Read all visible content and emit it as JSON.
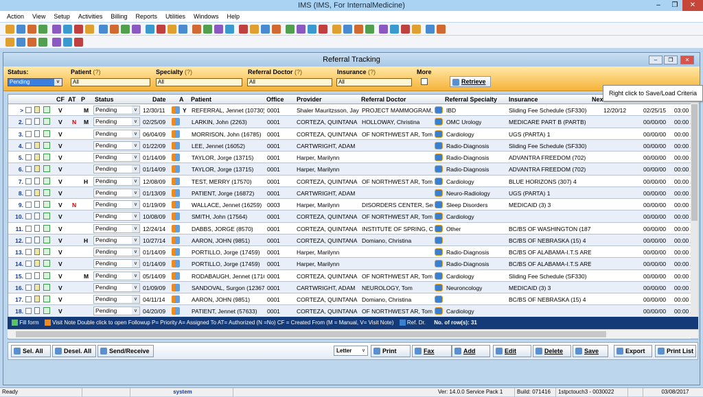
{
  "app": {
    "title": "IMS (IMS, For InternalMedicine)"
  },
  "menu": [
    "Action",
    "View",
    "Setup",
    "Activities",
    "Billing",
    "Reports",
    "Utilities",
    "Windows",
    "Help"
  ],
  "window": {
    "title": "Referral Tracking"
  },
  "filters": {
    "status_label": "Status:",
    "status_value": "Pending",
    "patient_label": "Patient",
    "patient_value": "All",
    "specialty_label": "Specialty",
    "specialty_value": "All",
    "refdoc_label": "Referral Doctor",
    "refdoc_value": "All",
    "insurance_label": "Insurance",
    "insurance_value": "All",
    "help": "(?)",
    "more_label": "More",
    "retrieve": "Retrieve"
  },
  "tooltip": "Right click to Save/Load Criteria",
  "columns": [
    "CF",
    "AT",
    "P",
    "Status",
    "Date",
    "A",
    "Patient",
    "Office",
    "Provider",
    "Referral Doctor",
    "Referral Specialty",
    "Insurance",
    "Nex"
  ],
  "rows": [
    {
      "n": ">",
      "doc": "y",
      "cf": "V",
      "at": "",
      "p": "M",
      "status": "Pending",
      "date": "12/30/11",
      "a": "Y",
      "patient": "REFERRAL, Jennet (10730)",
      "office": "0001",
      "provider": "Shaler Mauritzsson, Jay",
      "refdoc": "PROJECT MAMMOGRAM, J",
      "spec": "IBD",
      "ins": "Sliding Fee Schedule  (SF330)",
      "next": "12/20/12",
      "d2": "02/25/15",
      "t": "03:00 I"
    },
    {
      "n": "2.",
      "doc": "",
      "cf": "V",
      "at": "N",
      "p": "M",
      "status": "Pending",
      "date": "02/25/09",
      "a": "",
      "patient": "LARKIN, John (2263)",
      "office": "0001",
      "provider": "CORTEZA, QUINTANA",
      "refdoc": "HOLLOWAY, Christina",
      "spec": "OMC Urology",
      "ins": "MEDICARE PART B  (PARTB)",
      "next": "",
      "d2": "00/00/00",
      "t": "00:00 /"
    },
    {
      "n": "3.",
      "doc": "",
      "cf": "V",
      "at": "",
      "p": "",
      "status": "Pending",
      "date": "06/04/09",
      "a": "",
      "patient": "MORRISON, John (16785)",
      "office": "0001",
      "provider": "CORTEZA, QUINTANA",
      "refdoc": "OF NORTHWEST AR, Tom",
      "spec": "Cardiology",
      "ins": "UGS  (PARTA)  1",
      "next": "",
      "d2": "00/00/00",
      "t": "00:00 /"
    },
    {
      "n": "4.",
      "doc": "y",
      "cf": "V",
      "at": "",
      "p": "",
      "status": "Pending",
      "date": "01/22/09",
      "a": "",
      "patient": "LEE, Jennet (16052)",
      "office": "0001",
      "provider": "CARTWRIGHT, ADAM",
      "refdoc": "",
      "spec": "Radio-Diagnosis",
      "ins": "Sliding Fee Schedule  (SF330)",
      "next": "",
      "d2": "00/00/00",
      "t": "00:00 /"
    },
    {
      "n": "5.",
      "doc": "y",
      "cf": "V",
      "at": "",
      "p": "",
      "status": "Pending",
      "date": "01/14/09",
      "a": "",
      "patient": "TAYLOR, Jorge (13715)",
      "office": "0001",
      "provider": "Harper, Marilynn",
      "refdoc": "",
      "spec": "Radio-Diagnosis",
      "ins": "ADVANTRA FREEDOM    (702)",
      "next": "",
      "d2": "00/00/00",
      "t": "00:00 /"
    },
    {
      "n": "6.",
      "doc": "y",
      "cf": "V",
      "at": "",
      "p": "",
      "status": "Pending",
      "date": "01/14/09",
      "a": "",
      "patient": "TAYLOR, Jorge (13715)",
      "office": "0001",
      "provider": "Harper, Marilynn",
      "refdoc": "",
      "spec": "Radio-Diagnosis",
      "ins": "ADVANTRA FREEDOM    (702)",
      "next": "",
      "d2": "00/00/00",
      "t": "00:00 /"
    },
    {
      "n": "7.",
      "doc": "",
      "cf": "V",
      "at": "",
      "p": "H",
      "status": "Pending",
      "date": "12/08/09",
      "a": "",
      "patient": "TEST, MERRY (17570)",
      "office": "0001",
      "provider": "CORTEZA, QUINTANA",
      "refdoc": "OF NORTHWEST AR, Tom",
      "spec": "Cardiology",
      "ins": "BLUE HORIZONS  (307)   4",
      "next": "",
      "d2": "00/00/00",
      "t": "00:00 /"
    },
    {
      "n": "8.",
      "doc": "y",
      "cf": "V",
      "at": "",
      "p": "",
      "status": "Pending",
      "date": "01/13/09",
      "a": "",
      "patient": "PATIENT, Jorge (16872)",
      "office": "0001",
      "provider": "CARTWRIGHT, ADAM",
      "refdoc": "",
      "spec": "Neuro-Radiology",
      "ins": "UGS  (PARTA)  1",
      "next": "",
      "d2": "00/00/00",
      "t": "00:00 /"
    },
    {
      "n": "9.",
      "doc": "",
      "cf": "V",
      "at": "N",
      "p": "",
      "status": "Pending",
      "date": "01/19/09",
      "a": "",
      "patient": "WALLACE, Jennet (16259)",
      "office": "0003",
      "provider": "Harper, Marilynn",
      "refdoc": "DISORDERS CENTER, Serv",
      "spec": "Sleep Disorders",
      "ins": "MEDICAID  (3)  3",
      "next": "",
      "d2": "00/00/00",
      "t": "00:00 /"
    },
    {
      "n": "10.",
      "doc": "",
      "cf": "V",
      "at": "",
      "p": "",
      "status": "Pending",
      "date": "10/08/09",
      "a": "",
      "patient": "SMITH, John (17564)",
      "office": "0001",
      "provider": "CORTEZA, QUINTANA",
      "refdoc": "OF NORTHWEST AR, Tom",
      "spec": "Cardiology",
      "ins": "",
      "next": "",
      "d2": "00/00/00",
      "t": "00:00 /"
    },
    {
      "n": "11.",
      "doc": "",
      "cf": "V",
      "at": "",
      "p": "",
      "status": "Pending",
      "date": "12/24/14",
      "a": "",
      "patient": "DABBS, JORGE (8570)",
      "office": "0001",
      "provider": "CORTEZA, QUINTANA",
      "refdoc": "INSTITUTE OF SPRING, Ch",
      "spec": "Other",
      "ins": "BC/BS OF WASHINGTON  (187",
      "next": "",
      "d2": "00/00/00",
      "t": "00:00 /"
    },
    {
      "n": "12.",
      "doc": "",
      "cf": "V",
      "at": "",
      "p": "H",
      "status": "Pending",
      "date": "10/27/14",
      "a": "",
      "patient": "AARON, JOHN (9851)",
      "office": "0001",
      "provider": "CORTEZA, QUINTANA",
      "refdoc": "Domiano, Christina",
      "spec": "",
      "ins": "BC/BS OF NEBRASKA  (15)  4",
      "next": "",
      "d2": "00/00/00",
      "t": "00:00 /"
    },
    {
      "n": "13.",
      "doc": "y",
      "cf": "V",
      "at": "",
      "p": "",
      "status": "Pending",
      "date": "01/14/09",
      "a": "",
      "patient": "PORTILLO, Jorge (17459)",
      "office": "0001",
      "provider": "Harper, Marilynn",
      "refdoc": "",
      "spec": "Radio-Diagnosis",
      "ins": "BC/BS OF ALABAMA-I.T.S AREA",
      "next": "",
      "d2": "00/00/00",
      "t": "00:00 /"
    },
    {
      "n": "14.",
      "doc": "y",
      "cf": "V",
      "at": "",
      "p": "",
      "status": "Pending",
      "date": "01/14/09",
      "a": "",
      "patient": "PORTILLO, Jorge (17459)",
      "office": "0001",
      "provider": "Harper, Marilynn",
      "refdoc": "",
      "spec": "Radio-Diagnosis",
      "ins": "BC/BS OF ALABAMA-I.T.S AREA",
      "next": "",
      "d2": "00/00/00",
      "t": "00:00 /"
    },
    {
      "n": "15.",
      "doc": "",
      "cf": "V",
      "at": "",
      "p": "M",
      "status": "Pending",
      "date": "05/14/09",
      "a": "",
      "patient": "RODABAUGH, Jennet (17168",
      "office": "0001",
      "provider": "CORTEZA, QUINTANA",
      "refdoc": "OF NORTHWEST AR, Tom",
      "spec": "Cardiology",
      "ins": "Sliding Fee Schedule  (SF330)",
      "next": "",
      "d2": "00/00/00",
      "t": "00:00 /"
    },
    {
      "n": "16.",
      "doc": "y",
      "cf": "V",
      "at": "",
      "p": "",
      "status": "Pending",
      "date": "01/09/09",
      "a": "",
      "patient": "SANDOVAL, Surgon (12367)",
      "office": "0001",
      "provider": "CARTWRIGHT, ADAM",
      "refdoc": "NEUROLOGY, Tom",
      "spec": "Neuroncology",
      "ins": "MEDICAID  (3)  3",
      "next": "",
      "d2": "00/00/00",
      "t": "00:00 /"
    },
    {
      "n": "17.",
      "doc": "y",
      "cf": "V",
      "at": "",
      "p": "",
      "status": "Pending",
      "date": "04/11/14",
      "a": "",
      "patient": "AARON, JOHN (9851)",
      "office": "0001",
      "provider": "CORTEZA, QUINTANA",
      "refdoc": "Domiano, Christina",
      "spec": "",
      "ins": "BC/BS OF NEBRASKA  (15)  4",
      "next": "",
      "d2": "00/00/00",
      "t": "00:00 /"
    },
    {
      "n": "18.",
      "doc": "",
      "cf": "V",
      "at": "",
      "p": "",
      "status": "Pending",
      "date": "04/20/09",
      "a": "",
      "patient": "PATIENT, Jennet (57633)",
      "office": "0001",
      "provider": "CORTEZA, QUINTANA",
      "refdoc": "OF NORTHWEST AR, Tom",
      "spec": "Cardiology",
      "ins": "",
      "next": "",
      "d2": "00/00/00",
      "t": "00:00 /"
    }
  ],
  "legend": {
    "fill": "Fill form",
    "visit": "Visit Note",
    "text": "Double click to open Followup  P= Priority  A= Assigned To  AT= Authorized (N =No)  CF = Created From (M = Manual, V= Visit Note)",
    "refdr": "Ref. Dr.",
    "rowcount": "No. of row(s): 31"
  },
  "buttons": {
    "sel_all": "Sel. All",
    "desel_all": "Desel. All",
    "send_receive": "Send/Receive",
    "paper": "Letter",
    "print": "Print",
    "fax": "Fax",
    "add": "Add",
    "edit": "Edit",
    "delete": "Delete",
    "save": "Save",
    "export": "Export",
    "print_list": "Print List"
  },
  "statusbar": {
    "ready": "Ready",
    "user": "system",
    "version": "Ver: 14.0.0 Service Pack 1",
    "build": "Build: 071416",
    "server": "1stpctouch3 - 0030022",
    "date": "03/08/2017"
  },
  "colors": {
    "filter": "#f6b338",
    "legend": "#143a78",
    "at_no": "#d00000"
  }
}
